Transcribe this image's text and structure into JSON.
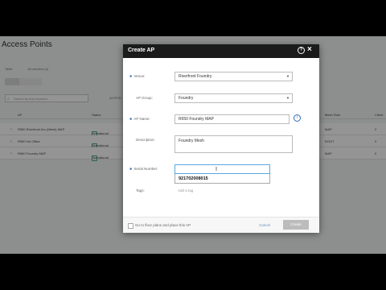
{
  "background": {
    "title": "Access Points",
    "tabs": [
      "Table",
      "All vendors (4)"
    ],
    "search_placeholder": "Search by any keyword...",
    "filter_label": "All RFID...",
    "columns": [
      "AP",
      "Status",
      "Mesh Role",
      "Client"
    ],
    "rows": [
      {
        "name": "R550 Riverfront Arc (Mesh) MAP",
        "status": "Operational",
        "role": "MAP",
        "client": "2"
      },
      {
        "name": "R550 Vol Office",
        "status": "Operational",
        "role": "ROOT",
        "client": "0"
      },
      {
        "name": "R650 Foundry MAP",
        "status": "Operational",
        "role": "MAP",
        "client": "0"
      }
    ]
  },
  "modal": {
    "title": "Create AP",
    "fields": {
      "venue": {
        "label": "Venue:",
        "value": "Riverfront Foundry"
      },
      "ap_group": {
        "label": "AP Group:",
        "value": "Foundry"
      },
      "ap_name": {
        "label": "AP Name:",
        "value": "R650 Foundry MAP"
      },
      "description": {
        "label": "Description:",
        "value": "Foundry Mesh"
      },
      "serial_number": {
        "label": "Serial Number:",
        "value": "",
        "suggestion": "921702008015"
      },
      "tags": {
        "label": "Tags:",
        "placeholder": "Add a tag"
      }
    },
    "footer": {
      "floorplan_label": "Go to floor plans and place this AP",
      "cancel_label": "Cancel",
      "create_label": "Create"
    }
  },
  "colors": {
    "modal_header": "#1b1b1b",
    "accent": "#2b6cb0",
    "disabled_button": "#bcbcbc"
  }
}
